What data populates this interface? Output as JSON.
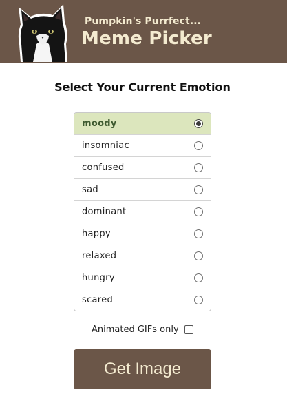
{
  "header": {
    "subtitle": "Pumpkin's Purrfect...",
    "title": "Meme Picker",
    "cat_image": "tuxedo-cat-photo"
  },
  "heading": "Select Your Current Emotion",
  "emotions": [
    {
      "label": "moody",
      "selected": true
    },
    {
      "label": "insomniac",
      "selected": false
    },
    {
      "label": "confused",
      "selected": false
    },
    {
      "label": "sad",
      "selected": false
    },
    {
      "label": "dominant",
      "selected": false
    },
    {
      "label": "happy",
      "selected": false
    },
    {
      "label": "relaxed",
      "selected": false
    },
    {
      "label": "hungry",
      "selected": false
    },
    {
      "label": "scared",
      "selected": false
    }
  ],
  "gif_option": {
    "label": "Animated GIFs only",
    "checked": false
  },
  "button": {
    "label": "Get Image"
  },
  "colors": {
    "brand_brown": "#6b5648",
    "header_text": "#f4ebd0",
    "selected_bg": "#dce6bd",
    "selected_text": "#3e5a30"
  }
}
